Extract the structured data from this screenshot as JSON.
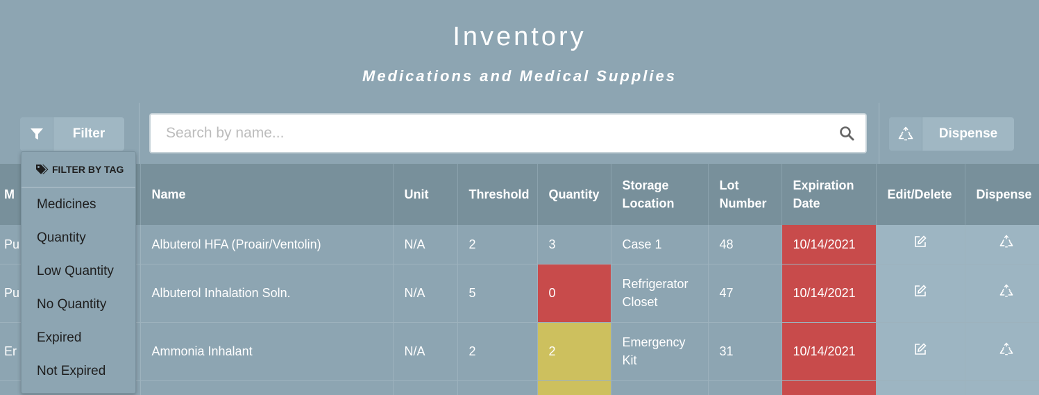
{
  "header": {
    "title": "Inventory",
    "subtitle": "Medications and Medical Supplies"
  },
  "toolbar": {
    "filter_label": "Filter",
    "search_placeholder": "Search by name...",
    "dispense_label": "Dispense"
  },
  "filter_menu": {
    "heading": "FILTER BY TAG",
    "items": [
      "Medicines",
      "Quantity",
      "Low Quantity",
      "No Quantity",
      "Expired",
      "Not Expired"
    ]
  },
  "table": {
    "headers": {
      "first": "M",
      "name": "Name",
      "unit": "Unit",
      "threshold": "Threshold",
      "quantity": "Quantity",
      "storage": "Storage Location",
      "lot": "Lot Number",
      "expiration": "Expiration Date",
      "edit": "Edit/Delete",
      "dispense": "Dispense"
    },
    "rows": [
      {
        "first": "Pu",
        "name": "Albuterol HFA (Proair/Ventolin)",
        "unit": "N/A",
        "threshold": "2",
        "quantity": "3",
        "storage": "Case 1",
        "lot": "48",
        "expiration": "10/14/2021"
      },
      {
        "first": "Pu",
        "name": "Albuterol Inhalation Soln.",
        "unit": "N/A",
        "threshold": "5",
        "quantity": "0",
        "storage": "Refrigerator Closet",
        "lot": "47",
        "expiration": "10/14/2021"
      },
      {
        "first": "Er",
        "name": "Ammonia Inhalant",
        "unit": "N/A",
        "threshold": "2",
        "quantity": "2",
        "storage": "Emergency Kit",
        "lot": "31",
        "expiration": "10/14/2021"
      }
    ]
  },
  "colors": {
    "background": "#8da5b2",
    "header_row": "#78909b",
    "expired": "#c84b4b",
    "low_quantity": "#cdc05e"
  }
}
